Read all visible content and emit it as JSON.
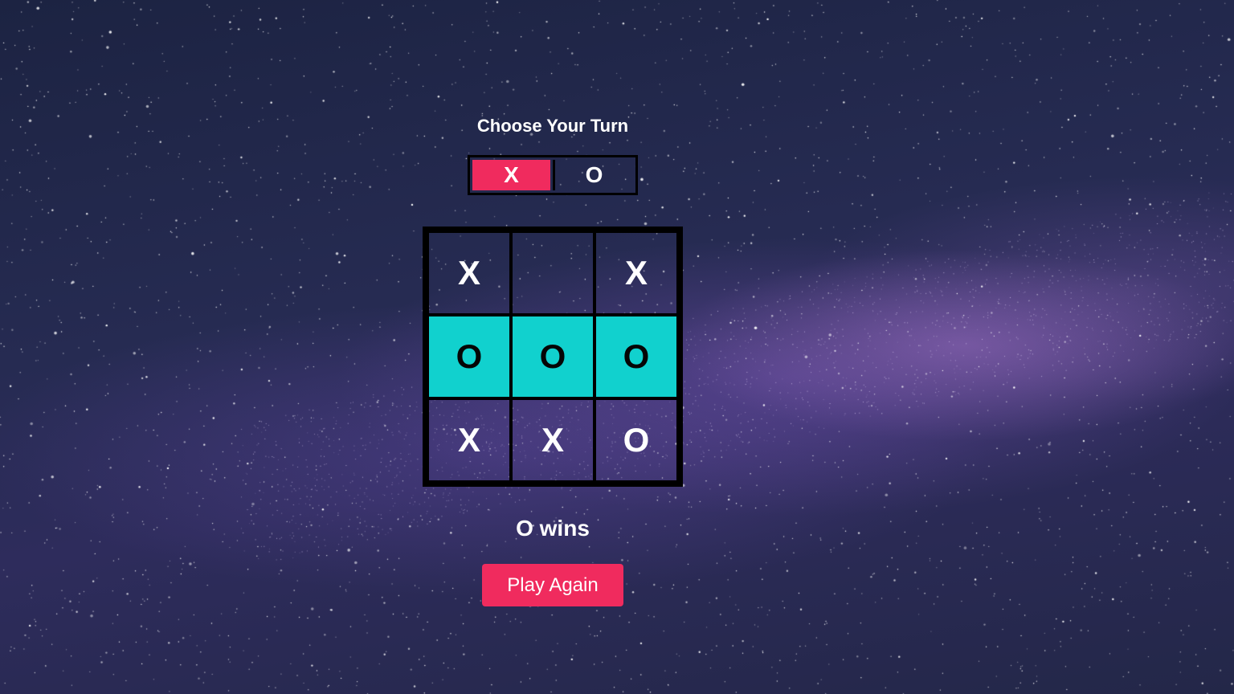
{
  "header": {
    "title": "Choose Your Turn"
  },
  "turn_selector": {
    "options": [
      "X",
      "O"
    ],
    "selected": "X"
  },
  "board": {
    "cells": [
      "X",
      "",
      "X",
      "O",
      "O",
      "O",
      "X",
      "X",
      "O"
    ],
    "winning_cells": [
      3,
      4,
      5
    ]
  },
  "status": {
    "result": "O wins"
  },
  "actions": {
    "play_again_label": "Play Again"
  },
  "colors": {
    "accent": "#f02b5e",
    "win_highlight": "#11d1ce",
    "grid_lines": "#000000",
    "text": "#ffffff"
  }
}
